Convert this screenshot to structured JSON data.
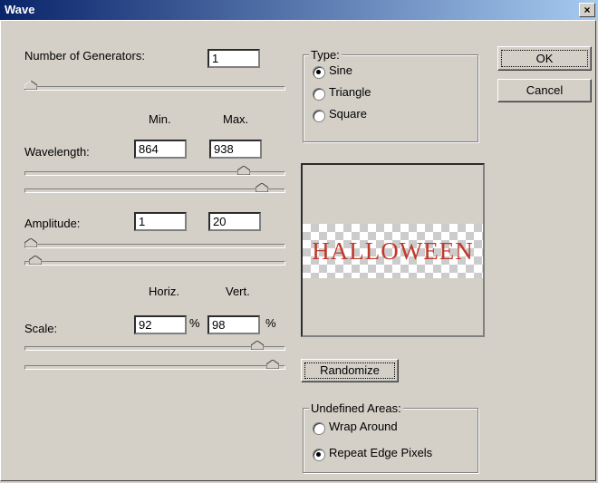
{
  "window": {
    "title": "Wave",
    "close_glyph": "×"
  },
  "generators": {
    "label": "Number of Generators:",
    "value": "1"
  },
  "column_headers": {
    "min": "Min.",
    "max": "Max.",
    "horiz": "Horiz.",
    "vert": "Vert."
  },
  "wavelength": {
    "label": "Wavelength:",
    "min": "864",
    "max": "938"
  },
  "amplitude": {
    "label": "Amplitude:",
    "min": "1",
    "max": "20"
  },
  "scale": {
    "label": "Scale:",
    "horiz": "92",
    "vert": "98",
    "unit": "%"
  },
  "type": {
    "title": "Type:",
    "options": [
      "Sine",
      "Triangle",
      "Square"
    ],
    "selected": "Sine"
  },
  "buttons": {
    "ok": "OK",
    "cancel": "Cancel",
    "randomize": "Randomize"
  },
  "preview": {
    "text": "HALLOWEEN"
  },
  "undefined_areas": {
    "title": "Undefined Areas:",
    "options": [
      "Wrap Around",
      "Repeat Edge Pixels"
    ],
    "selected": "Repeat Edge Pixels"
  },
  "colors": {
    "title_bar": "#0a246a",
    "preview_text": "#c0392b",
    "dialog_bg": "#d4d0c8"
  },
  "sliders": {
    "generators": 0.0,
    "wavelength_min": 0.864,
    "wavelength_max": 0.938,
    "amplitude_min": 0.0,
    "amplitude_max": 0.02,
    "scale_horiz": 0.92,
    "scale_vert": 0.98
  }
}
